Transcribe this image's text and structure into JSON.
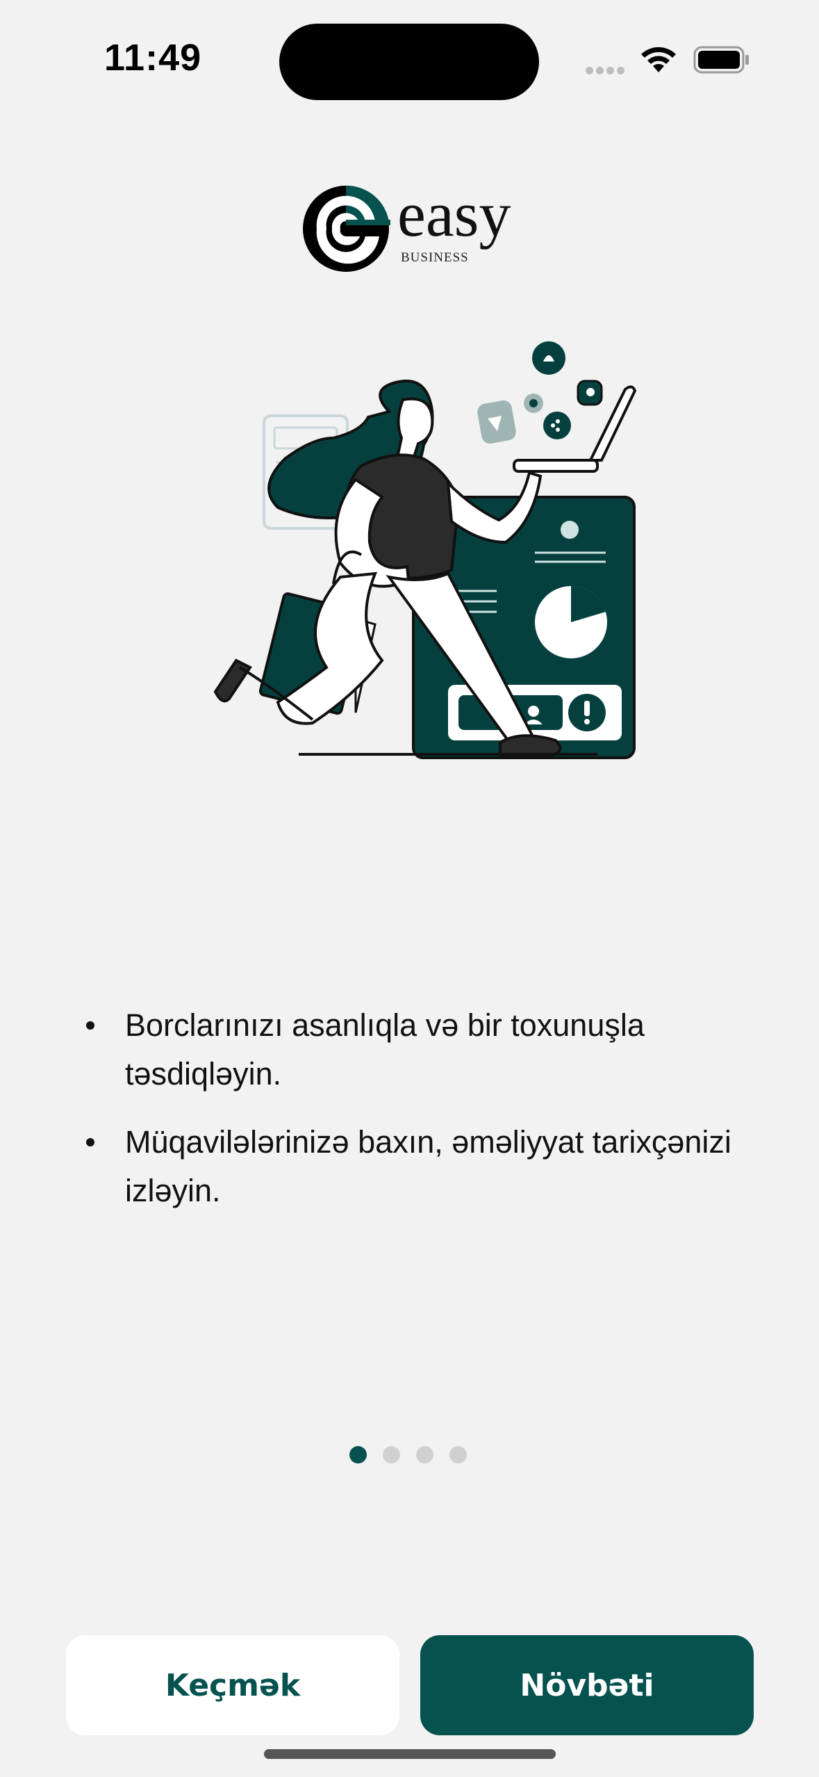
{
  "status_bar": {
    "time": "11:49",
    "icons": [
      "cellular-signal-icon",
      "wifi-icon",
      "battery-icon"
    ]
  },
  "logo": {
    "word": "easy",
    "subtitle": "BUSINESS"
  },
  "colors": {
    "brand": "#05524f",
    "background": "#f2f2f2",
    "inactive_dot": "#d0d0d0"
  },
  "bullets": [
    "Borclarınızı asanlıqla və bir toxunuşla təsdiqləyin.",
    "Müqavilələrinizə baxın, əməliyyat tarixçənizi izləyin."
  ],
  "pager": {
    "current": 1,
    "total": 4
  },
  "buttons": {
    "skip": "Keçmək",
    "next": "Növbəti"
  }
}
